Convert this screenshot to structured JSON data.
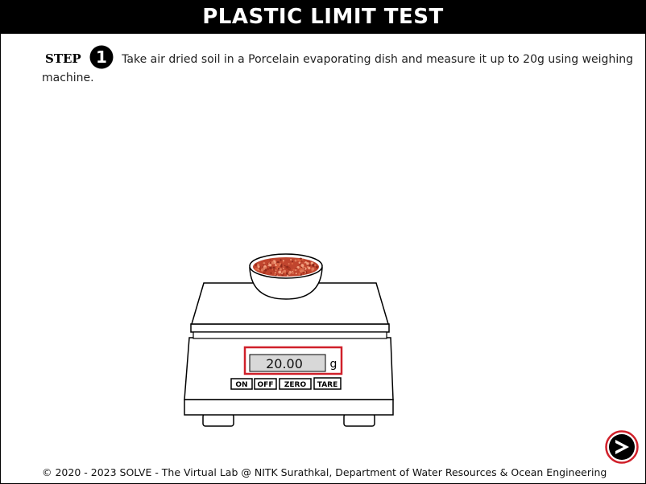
{
  "header": {
    "title": "PLASTIC LIMIT TEST"
  },
  "step": {
    "label": "STEP",
    "number": "1",
    "text": "Take air dried soil in a Porcelain evaporating dish and measure it up to 20g using weighing machine."
  },
  "scale": {
    "display_value": "20.00",
    "unit": "g",
    "buttons": {
      "on": "ON",
      "off": "OFF",
      "zero": "ZERO",
      "tare": "TARE"
    },
    "highlight_color": "#d0202a",
    "soil_color": "#c0452e"
  },
  "footer": {
    "copyright": "© 2020 - 2023 SOLVE - The Virtual Lab @ NITK Surathkal, Department of Water Resources & Ocean Engineering"
  },
  "next_button": {
    "icon": "arrow-right-icon",
    "ring_color": "#d0202a"
  }
}
